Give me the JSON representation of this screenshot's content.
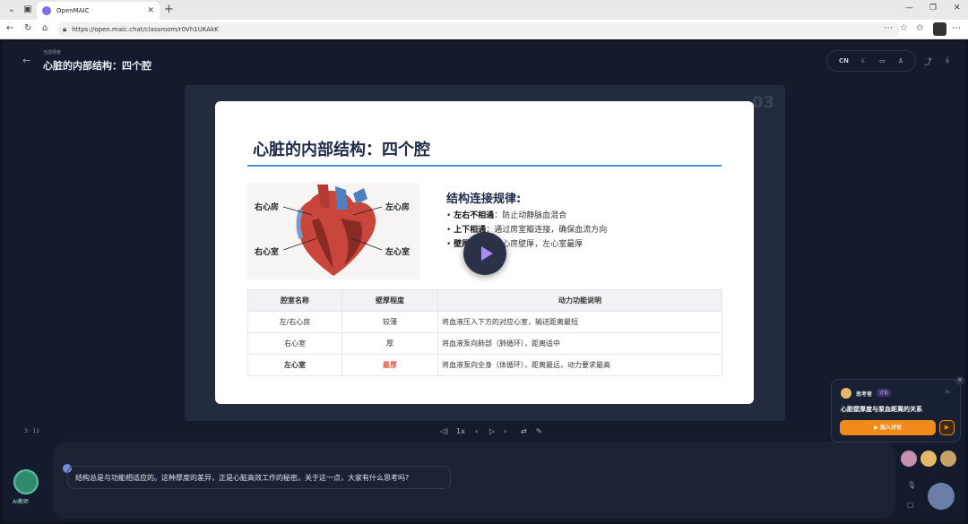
{
  "browser": {
    "tab_title": "OpenMAIC",
    "url": "https://open.maic.chat/classroom/r0Vh1UKAkK"
  },
  "header": {
    "small_label": "当前场景",
    "title": "心脏的内部结构：四个腔",
    "lang": "CN"
  },
  "slide": {
    "page_number": "03",
    "title": "心脏的内部结构：四个腔",
    "heart_labels": [
      "右心房",
      "左心房",
      "右心室",
      "左心室"
    ],
    "rules_heading": "结构连接规律:",
    "rules": [
      {
        "bold": "左右不相通",
        "text": "：防止动静脉血混合"
      },
      {
        "bold": "上下相通",
        "text": "：通过房室瓣连接，确保血流方向"
      },
      {
        "bold": "壁厚",
        "text": "心室壁比心房壁厚，左心室最厚"
      }
    ],
    "table": {
      "headers": [
        "腔室名称",
        "壁厚程度",
        "动力功能说明"
      ],
      "rows": [
        [
          "左/右心房",
          "较薄",
          "将血液压入下方的对应心室，输送距离最短"
        ],
        [
          "右心室",
          "厚",
          "将血液泵向肺部（肺循环），距离适中"
        ],
        [
          "左心室",
          "最厚",
          "将血液泵向全身（体循环），距离最远，动力要求最高"
        ]
      ],
      "highlight_color": "#e05a4a"
    }
  },
  "playbar": {
    "page": "3 · 11",
    "speed": "1x"
  },
  "chat": {
    "message": "结构总是与功能相适应的。这种厚度的差异，正是心脏高效工作的秘密。关于这一点，大家有什么思考吗?",
    "teacher_label": "AI教师"
  },
  "popup": {
    "name": "思考者",
    "tag": "讨论",
    "time": "3s",
    "question": "心脏壁厚度与泵血距离的关系",
    "button": "加入讨论"
  }
}
